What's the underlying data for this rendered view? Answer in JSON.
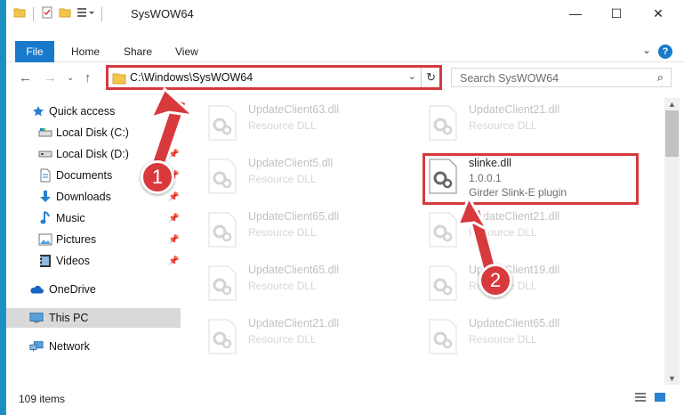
{
  "window": {
    "title": "SysWOW64",
    "controls": {
      "minimize": "—",
      "maximize": "☐",
      "close": "✕"
    }
  },
  "ribbon": {
    "file_tab": "File",
    "tabs": [
      "Home",
      "Share",
      "View"
    ],
    "help": "?"
  },
  "address_bar": {
    "path": "C:\\Windows\\SysWOW64",
    "refresh_icon": "↻"
  },
  "search": {
    "placeholder": "Search SysWOW64"
  },
  "sidebar": {
    "items": [
      {
        "label": "Quick access",
        "icon": "star-icon",
        "pinned": false
      },
      {
        "label": "Local Disk (C:)",
        "icon": "drive-icon",
        "pinned": true
      },
      {
        "label": "Local Disk (D:)",
        "icon": "drive-icon",
        "pinned": true
      },
      {
        "label": "Documents",
        "icon": "documents-icon",
        "pinned": true
      },
      {
        "label": "Downloads",
        "icon": "downloads-icon",
        "pinned": true
      },
      {
        "label": "Music",
        "icon": "music-icon",
        "pinned": true
      },
      {
        "label": "Pictures",
        "icon": "pictures-icon",
        "pinned": true
      },
      {
        "label": "Videos",
        "icon": "videos-icon",
        "pinned": true
      },
      {
        "label": "OneDrive",
        "icon": "onedrive-icon",
        "pinned": false
      },
      {
        "label": "This PC",
        "icon": "this-pc-icon",
        "pinned": false,
        "selected": true
      },
      {
        "label": "Network",
        "icon": "network-icon",
        "pinned": false
      }
    ]
  },
  "files": [
    {
      "name": "UpdateClient63.dll",
      "subtitle": "Resource DLL"
    },
    {
      "name": "UpdateClient21.dll",
      "subtitle": "Resource DLL"
    },
    {
      "name": "UpdateClient5.dll",
      "subtitle": "Resource DLL"
    },
    {
      "name": "slinke.dll",
      "version": "1.0.0.1",
      "description": "Girder Slink-E plugin",
      "highlighted": true
    },
    {
      "name": "UpdateClient65.dll",
      "subtitle": "Resource DLL"
    },
    {
      "name": "UpdateClient21.dll",
      "subtitle": "Resource DLL"
    },
    {
      "name": "UpdateClient65.dll",
      "subtitle": "Resource DLL"
    },
    {
      "name": "UpdateClient19.dll",
      "subtitle": "Resource DLL"
    },
    {
      "name": "UpdateClient21.dll",
      "subtitle": "Resource DLL"
    },
    {
      "name": "UpdateClient65.dll",
      "subtitle": "Resource DLL"
    }
  ],
  "status": {
    "item_count": "109 items"
  },
  "annotations": {
    "step1": "1",
    "step2": "2",
    "color": "#d8393d"
  }
}
